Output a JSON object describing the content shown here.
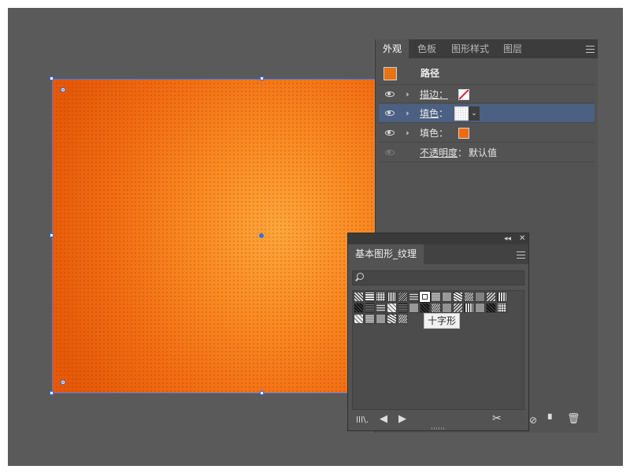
{
  "appearance_panel": {
    "tabs": [
      "外观",
      "色板",
      "图形样式",
      "图层"
    ],
    "active_tab": "外观",
    "object_label": "路径",
    "rows": [
      {
        "label": "描边",
        "colon": "：",
        "swatch": "stroke-red-slash-icon"
      },
      {
        "label": "填色",
        "colon": "：",
        "swatch": "pattern-dots-swatch",
        "selected": true
      },
      {
        "label": "填色",
        "colon": "：",
        "swatch": "orange-swatch"
      },
      {
        "label": "不透明度",
        "colon": "：",
        "value": "默认值"
      }
    ],
    "colors": {
      "orange": "#ef6a10",
      "stroke": "#d4202a",
      "selected_row": "#4b6082"
    }
  },
  "swatch_library_panel": {
    "tab_title": "基本图形_纹理",
    "search_placeholder": "",
    "tooltip": "十字形"
  },
  "artwork": {
    "gradient_colors": [
      "#fda63a",
      "#f98a22",
      "#f16c12",
      "#e55a08"
    ],
    "selection_color": "#4a7df0"
  }
}
